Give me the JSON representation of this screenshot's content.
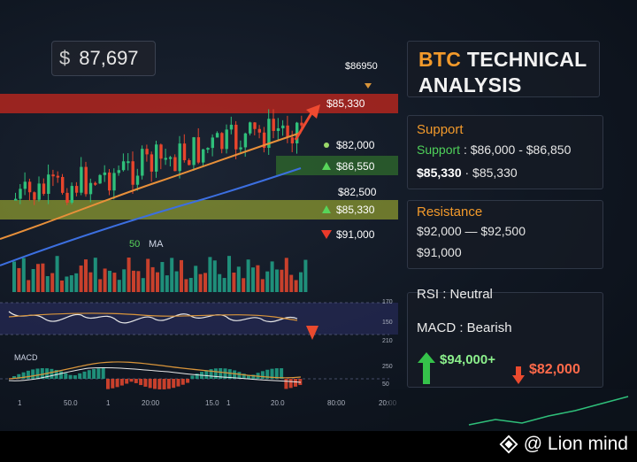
{
  "price": {
    "symbol": "$",
    "value": "87,697"
  },
  "header": {
    "title_accent": "BTC",
    "title_rest": "TECHNICAL",
    "title_line2": "ANALYSIS"
  },
  "chart": {
    "top_label": "$86950",
    "level_labels": {
      "resistance_band": "$85,330",
      "dot_level": "$82,000",
      "green_level": "$86,550",
      "mid_level": "$82,500",
      "support_band": "$85,330",
      "red_level": "$91,000"
    },
    "ma_label_value": "50",
    "ma_label_text": "MA",
    "macd_label": "MACD",
    "right_axis_ticks": [
      "170",
      "150",
      "210",
      "250",
      "50"
    ],
    "x_ticks": [
      "1",
      "50.0",
      "1",
      "20:00",
      "15.0",
      "1",
      "20.0",
      "80:00",
      "20:00"
    ]
  },
  "side": {
    "support": {
      "heading": "Support",
      "range_key": "Support",
      "range_value": ": $86,000 - $86,850",
      "pair_key": "$85,330",
      "pair_value": "· $85,330"
    },
    "resistance": {
      "heading": "Resistance",
      "range": "$92,000 — $92,500",
      "extra": "$91,000"
    },
    "indicators": {
      "rsi_key": "RSI",
      "rsi_value": ": Neutral",
      "macd_key": "MACD",
      "macd_value": ": Bearish",
      "target_up": "$94,000+",
      "target_down": "$82,000"
    }
  },
  "watermark": {
    "text": "@ Lion mind"
  },
  "colors": {
    "accent_orange": "#f39a2b",
    "bull_green": "#2fbf7a",
    "bear_red": "#e8452c",
    "resistance_band": "#c0271e",
    "support_band": "#c8d23a"
  }
}
